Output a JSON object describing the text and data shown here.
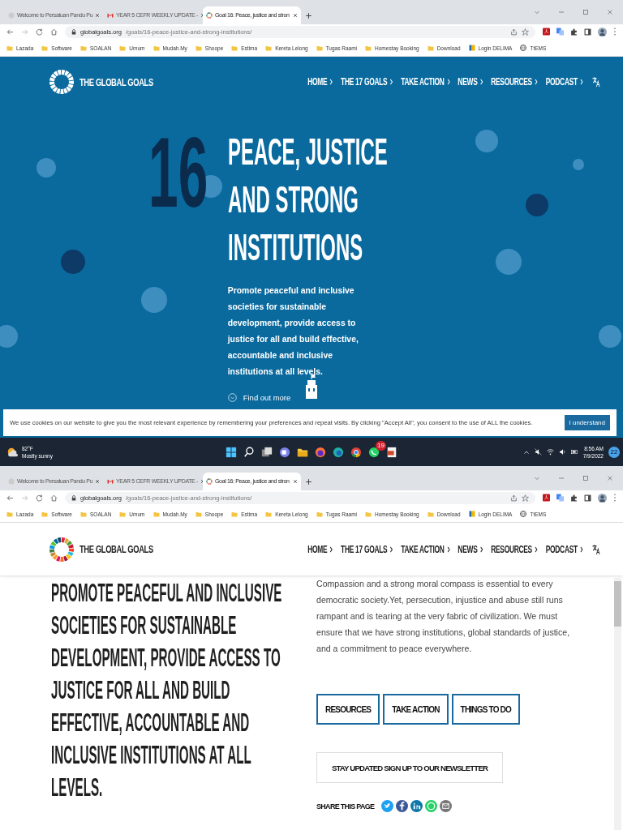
{
  "top_screen": {
    "browser": {
      "tabs": [
        {
          "label": "Welcome to Persatuan Pandu Pu",
          "selected": false
        },
        {
          "label": "YEAR 5 CEFR WEEKLY UPDATE -",
          "selected": false
        },
        {
          "label": "Goal 16: Peace, justice and stron",
          "selected": true
        }
      ],
      "url": {
        "domain": "globalgoals.org",
        "path": "/goals/16-peace-justice-and-strong-institutions/"
      },
      "bookmarks": [
        {
          "label": "Lazada",
          "kind": "folder"
        },
        {
          "label": "Software",
          "kind": "folder"
        },
        {
          "label": "SOALAN",
          "kind": "folder"
        },
        {
          "label": "Umum",
          "kind": "folder"
        },
        {
          "label": "Mudah.My",
          "kind": "folder"
        },
        {
          "label": "Shoope",
          "kind": "folder"
        },
        {
          "label": "Estima",
          "kind": "folder"
        },
        {
          "label": "Kereta Lelong",
          "kind": "folder"
        },
        {
          "label": "Tugas Raami",
          "kind": "folder"
        },
        {
          "label": "Homestay Booking",
          "kind": "folder"
        },
        {
          "label": "Download",
          "kind": "folder"
        },
        {
          "label": "Login DELIMA",
          "kind": "link"
        },
        {
          "label": "TtEMS",
          "kind": "link"
        }
      ]
    },
    "header": {
      "logo": "THE GLOBAL GOALS",
      "nav": [
        "HOME",
        "THE 17 GOALS",
        "TAKE ACTION",
        "NEWS",
        "RESOURCES",
        "PODCAST"
      ]
    },
    "hero": {
      "number": "16",
      "title": "PEACE, JUSTICE AND STRONG INSTITUTIONS",
      "description": "Promote peaceful and inclusive societies for sustainable development, provide access to justice for all and build effective, accountable and inclusive institutions at all levels.",
      "link": "Find out more"
    },
    "cookie_bar": {
      "text": "We use cookies on our website to give you the most relevant experience by remembering your preferences and repeat visits. By clicking \"Accept All\", you consent to the use of ALL the cookies.",
      "button": "I understand"
    },
    "taskbar": {
      "temperature": "82°F",
      "weather": "Mostly sunny",
      "whatsapp_badge": "19",
      "time": "8:56 AM",
      "date": "7/9/2022",
      "notifications": "22"
    }
  },
  "bottom_screen": {
    "browser": {
      "tabs": [
        {
          "label": "Welcome to Persatuan Pandu Pu",
          "selected": false
        },
        {
          "label": "YEAR 5 CEFR WEEKLY UPDATE -",
          "selected": false
        },
        {
          "label": "Goal 16: Peace, justice and stron",
          "selected": true
        }
      ],
      "url": {
        "domain": "globalgoals.org",
        "path": "/goals/16-peace-justice-and-strong-institutions/"
      },
      "bookmarks": [
        {
          "label": "Lazada",
          "kind": "folder"
        },
        {
          "label": "Software",
          "kind": "folder"
        },
        {
          "label": "SOALAN",
          "kind": "folder"
        },
        {
          "label": "Umum",
          "kind": "folder"
        },
        {
          "label": "Mudah.My",
          "kind": "folder"
        },
        {
          "label": "Shoope",
          "kind": "folder"
        },
        {
          "label": "Estima",
          "kind": "folder"
        },
        {
          "label": "Kereta Lelong",
          "kind": "folder"
        },
        {
          "label": "Tugas Raami",
          "kind": "folder"
        },
        {
          "label": "Homestay Booking",
          "kind": "folder"
        },
        {
          "label": "Download",
          "kind": "folder"
        },
        {
          "label": "Login DELIMA",
          "kind": "link"
        },
        {
          "label": "TtEMS",
          "kind": "link"
        }
      ]
    },
    "header": {
      "logo": "THE GLOBAL GOALS",
      "nav": [
        "HOME",
        "THE 17 GOALS",
        "TAKE ACTION",
        "NEWS",
        "RESOURCES",
        "PODCAST"
      ]
    },
    "heading": "PROMOTE PEACEFUL AND INCLUSIVE SOCIETIES FOR SUSTAINABLE DEVELOPMENT, PROVIDE ACCESS TO JUSTICE FOR ALL AND BUILD EFFECTIVE, ACCOUNTABLE AND INCLUSIVE INSTITUTIONS AT ALL LEVELS.",
    "body": "Compassion and a strong moral compass is essential to every democratic society.Yet, persecution, injustice and abuse still runs rampant and is tearing at the very fabric of civilization. We must ensure that we have strong institutions, global standards of justice, and a commitment to peace everywhere.",
    "buttons": [
      "RESOURCES",
      "TAKE ACTION",
      "THINGS TO DO"
    ],
    "newsletter": "STAY UPDATED SIGN UP TO OUR NEWSLETTER",
    "share_label": "SHARE THIS PAGE"
  }
}
